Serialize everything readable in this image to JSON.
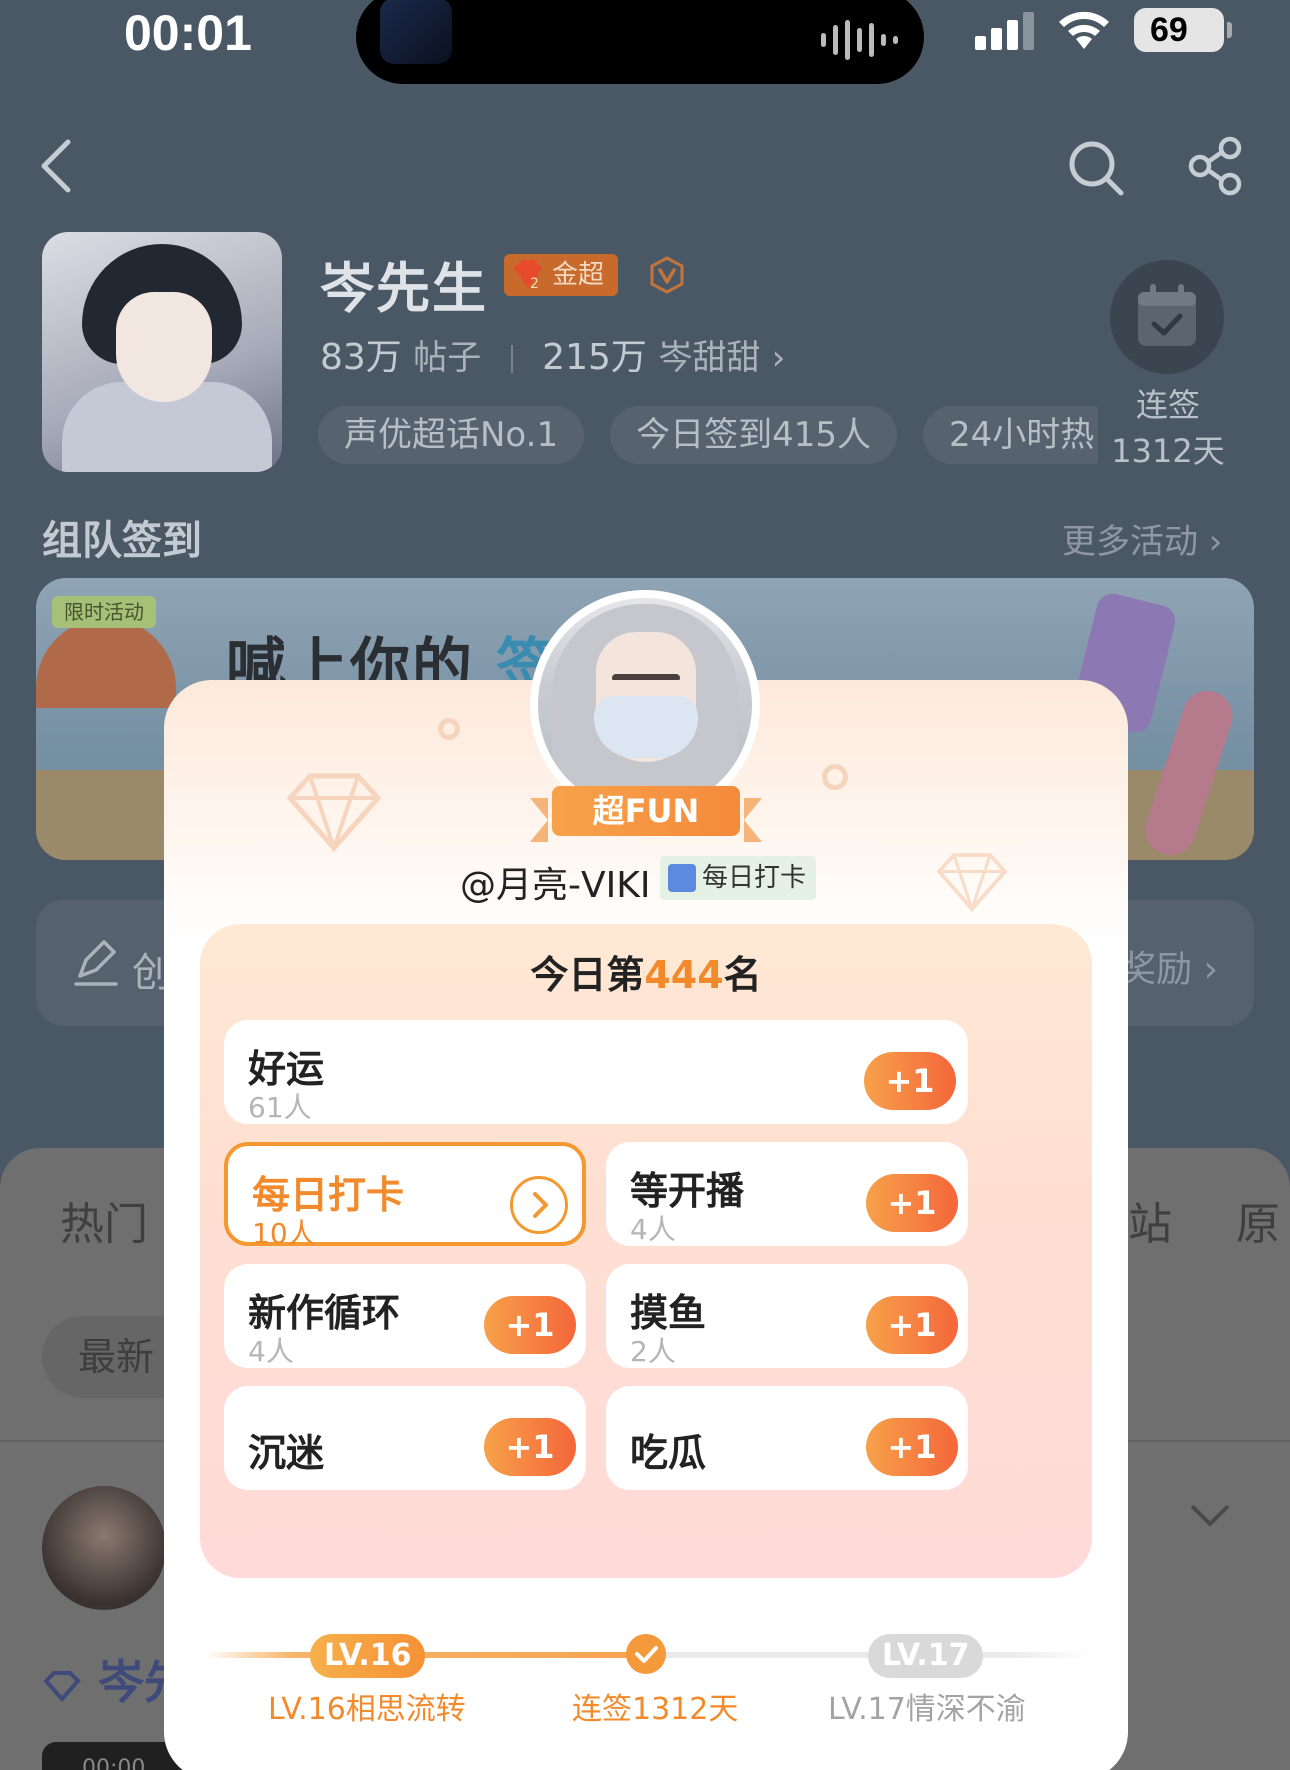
{
  "status_bar": {
    "time": "00:01",
    "battery": "69"
  },
  "profile": {
    "name": "岑先生",
    "badge": "金超",
    "posts_count": "83万",
    "posts_label": "帖子",
    "fans_count": "215万",
    "fans_label": "岑甜甜",
    "chips": [
      "声优超话No.1",
      "今日签到415人",
      "24小时热"
    ],
    "streak_label": "连签",
    "streak_days": "1312天"
  },
  "team_checkin": {
    "title": "组队签到",
    "more": "更多活动"
  },
  "banner": {
    "tag": "限时活动",
    "headline": "喊上你的",
    "headline2": "签"
  },
  "create_row": {
    "label": "创",
    "reward": "奖励"
  },
  "background_sheet": {
    "tabs": [
      "热门",
      "站",
      "原"
    ],
    "newest": "最新",
    "author_partial": "岑先",
    "video_time": "00:00"
  },
  "popup": {
    "ribbon": "超FUN",
    "user_handle": "@月亮-VIKI",
    "user_tag": "每日打卡",
    "rank_prefix": "今日第",
    "rank_number": "444",
    "rank_suffix": "名",
    "plus_label": "+1",
    "options": [
      {
        "name": "好运",
        "count": "61人"
      },
      {
        "name": "每日打卡",
        "count": "10人"
      },
      {
        "name": "等开播",
        "count": "4人"
      },
      {
        "name": "新作循环",
        "count": "4人"
      },
      {
        "name": "摸鱼",
        "count": "2人"
      },
      {
        "name": "沉迷",
        "count": ""
      },
      {
        "name": "吃瓜",
        "count": ""
      }
    ],
    "level": {
      "current_pill": "LV.16",
      "next_pill": "LV.17",
      "current_label": "LV.16相思流转",
      "streak_label": "连签1312天",
      "next_label": "LV.17情深不渝"
    }
  },
  "colors": {
    "accent": "#f28a2c",
    "plus_gradient_start": "#f7a14a",
    "plus_gradient_end": "#f4663a"
  }
}
